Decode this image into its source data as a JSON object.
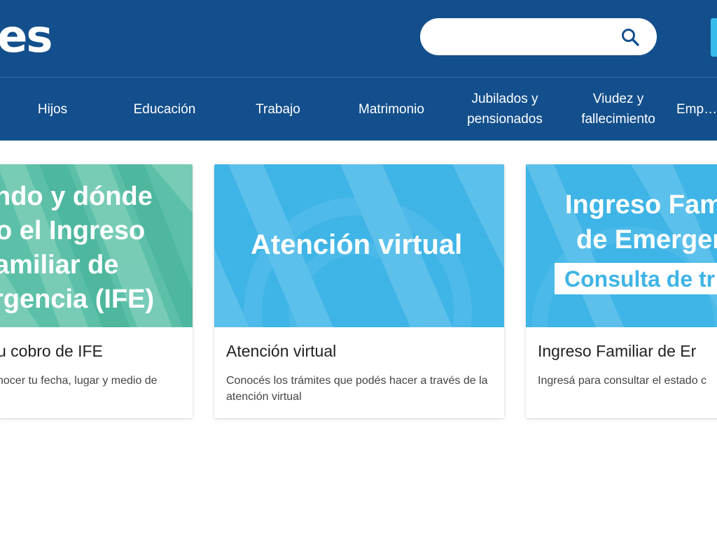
{
  "header": {
    "logo_text": "es",
    "search": {
      "placeholder": ""
    }
  },
  "nav": {
    "items": [
      {
        "label": "Hijos"
      },
      {
        "label": "Educación"
      },
      {
        "label": "Trabajo"
      },
      {
        "label": "Matrimonio"
      },
      {
        "label": "Jubilados y pensionados"
      },
      {
        "label": "Viudez y fallecimiento"
      },
      {
        "label": "Emp… org…"
      }
    ]
  },
  "cards": [
    {
      "banner_lines": [
        "ndo y dónde",
        "o el Ingreso",
        "amiliar de",
        "rgencia (IFE)"
      ],
      "title": "u cobro de IFE",
      "description": "nocer tu fecha, lugar y medio de"
    },
    {
      "banner_lines": [
        "Atención virtual"
      ],
      "title": "Atención virtual",
      "description": "Conocés los trámites que podés hacer a través de la atención virtual"
    },
    {
      "banner_lines": [
        "Ingreso Fam",
        "de Emerger"
      ],
      "banner_tag": "Consulta de tr",
      "title": "Ingreso Familiar de Er",
      "description": "Ingresá para consultar el estado c"
    }
  ],
  "colors": {
    "header_bg": "#134f8c",
    "banner_teal": "#5cc0a8",
    "banner_blue": "#3fb4e6",
    "accent_cyan": "#37bbed"
  }
}
